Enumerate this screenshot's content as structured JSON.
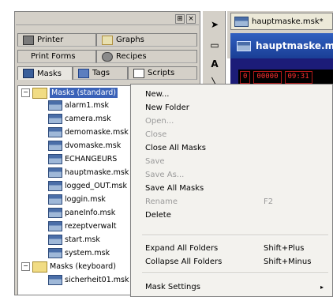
{
  "tabs_row1": [
    {
      "label": "Printer",
      "icon": "printer-icon"
    },
    {
      "label": "Graphs",
      "icon": "graph-icon"
    }
  ],
  "tabs_row2": [
    {
      "label": "Print Forms"
    },
    {
      "label": "Recipes",
      "icon": "recipe-icon"
    }
  ],
  "tabs_row3": [
    {
      "label": "Masks",
      "icon": "mask-icon"
    },
    {
      "label": "Tags",
      "icon": "tag-icon"
    },
    {
      "label": "Scripts",
      "icon": "script-icon"
    }
  ],
  "pane_buttons": {
    "pin": "⊞",
    "close": "×"
  },
  "tree": {
    "root": "Masks (standard)",
    "files": [
      "alarm1.msk",
      "camera.msk",
      "demomaske.msk",
      "dvomaske.msk",
      "ECHANGEURS",
      "hauptmaske.msk",
      "logged_OUT.msk",
      "loggin.msk",
      "paneInfo.msk",
      "rezeptverwalt",
      "start.msk",
      "system.msk"
    ],
    "root2": "Masks (keyboard)",
    "files2": [
      "sicherheit01.msk"
    ]
  },
  "editor": {
    "tab_label": "hauptmaske.msk*",
    "title": "hauptmaske.msk",
    "leds": [
      "0",
      "00000",
      "09:31"
    ]
  },
  "toolbar": {
    "icons": [
      "pointer-icon",
      "rectangle-icon",
      "text-icon",
      "line-icon"
    ]
  },
  "context_menu": {
    "items": [
      {
        "label": "New...",
        "enabled": true
      },
      {
        "label": "New Folder",
        "enabled": true
      },
      {
        "label": "Open...",
        "enabled": false
      },
      {
        "label": "Close",
        "enabled": false
      },
      {
        "label": "Close All Masks",
        "enabled": true
      },
      {
        "label": "Save",
        "enabled": false
      },
      {
        "label": "Save As...",
        "enabled": false
      },
      {
        "label": "Save All Masks",
        "enabled": true
      },
      {
        "label": "Rename",
        "enabled": false,
        "shortcut": "F2"
      },
      {
        "label": "Delete",
        "enabled": true
      },
      {
        "label": "Expand All Folders",
        "enabled": true,
        "shortcut": "Shift+Plus"
      },
      {
        "label": "Collapse All Folders",
        "enabled": true,
        "shortcut": "Shift+Minus"
      },
      {
        "label": "Mask Settings",
        "enabled": true,
        "submenu": true
      }
    ],
    "submenu_arrow": "▸"
  }
}
